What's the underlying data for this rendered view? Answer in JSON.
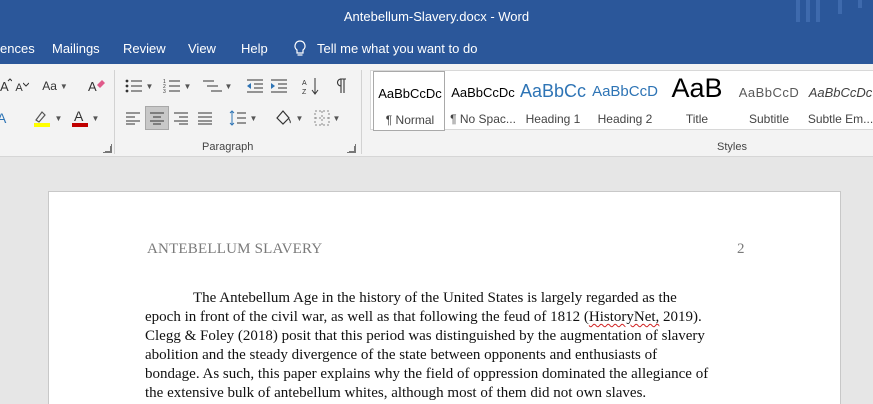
{
  "window": {
    "title": "Antebellum-Slavery.docx  -  Word"
  },
  "ribbon_tabs": [
    {
      "label": "ences"
    },
    {
      "label": "Mailings"
    },
    {
      "label": "Review"
    },
    {
      "label": "View"
    },
    {
      "label": "Help"
    }
  ],
  "tell_me": {
    "placeholder": "Tell me what you want to do"
  },
  "font_group": {
    "change_case_label": "Aa",
    "shrink_font_label": "A",
    "font_color": "#c00000",
    "highlight_color": "#ffff00"
  },
  "groups": {
    "paragraph_label": "Paragraph",
    "styles_label": "Styles"
  },
  "styles": [
    {
      "preview": "AaBbCcDc",
      "name": "¶ Normal",
      "color": "#000000",
      "selected": true
    },
    {
      "preview": "AaBbCcDc",
      "name": "¶ No Spac...",
      "color": "#000000",
      "selected": false
    },
    {
      "preview": "AaBbCc",
      "name": "Heading 1",
      "color": "#2e74b5",
      "selected": false
    },
    {
      "preview": "AaBbCcD",
      "name": "Heading 2",
      "color": "#2e74b5",
      "selected": false
    },
    {
      "preview": "AaB",
      "name": "Title",
      "color": "#000000",
      "selected": false
    },
    {
      "preview": "AaBbCcD",
      "name": "Subtitle",
      "color": "#595959",
      "selected": false
    },
    {
      "preview": "AaBbCcDc",
      "name": "Subtle Em...",
      "color": "#404040",
      "selected": false
    }
  ],
  "document": {
    "header_text": "ANTEBELLUM SLAVERY",
    "page_number": "2",
    "lines": [
      "The Antebellum Age in the history of the United States is largely regarded as the",
      "epoch in front of the civil war, as well as that following the feud of 1812 (",
      "HistoryNet,",
      " 2019).",
      "Clegg & Foley (2018) posit that this period was distinguished by the augmentation of slavery",
      "abolition and the steady divergence of the state between opponents and enthusiasts of",
      "bondage. As such, this paper explains why the field of oppression dominated the allegiance of",
      "the extensive bulk of antebellum whites, although most of them did not own slaves."
    ]
  }
}
